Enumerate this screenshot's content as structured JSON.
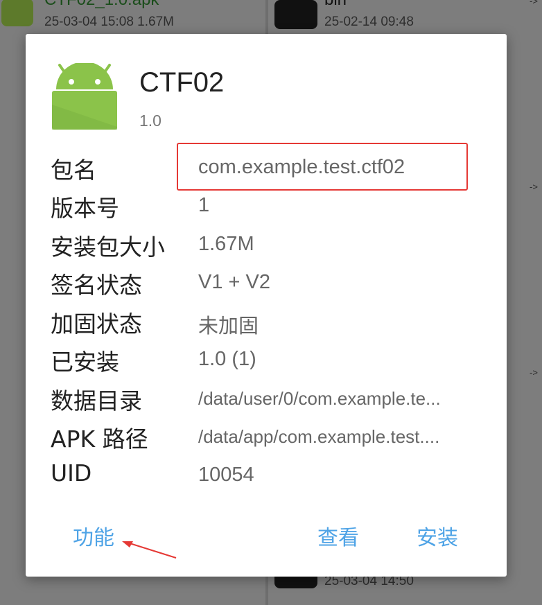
{
  "background": {
    "files": [
      {
        "name": "CTF02_1.0.apk",
        "meta": "25-03-04 15:08  1.67M"
      },
      {
        "name": "bin",
        "meta": "25-02-14 09:48"
      },
      {
        "meta": "25-03-04 14:50"
      }
    ],
    "arrow_text": "->"
  },
  "dialog": {
    "app_name": "CTF02",
    "version": "1.0",
    "rows": [
      {
        "label": "包名",
        "value": "com.example.test.ctf02"
      },
      {
        "label": "版本号",
        "value": "1"
      },
      {
        "label": "安装包大小",
        "value": "1.67M"
      },
      {
        "label": "签名状态",
        "value": "V1 + V2"
      },
      {
        "label": "加固状态",
        "value": "未加固"
      },
      {
        "label": "已安装",
        "value": "1.0 (1)"
      },
      {
        "label": "数据目录",
        "value": "/data/user/0/com.example.te..."
      },
      {
        "label": "APK 路径",
        "value": "/data/app/com.example.test...."
      },
      {
        "label": "UID",
        "value": "10054"
      }
    ],
    "buttons": {
      "functions": "功能",
      "view": "查看",
      "install": "安装"
    }
  },
  "colors": {
    "accent": "#4ea3e6",
    "android_green": "#8bc34a",
    "highlight": "#e53935"
  },
  "icons": {
    "app_icon": "android-robot-icon"
  }
}
